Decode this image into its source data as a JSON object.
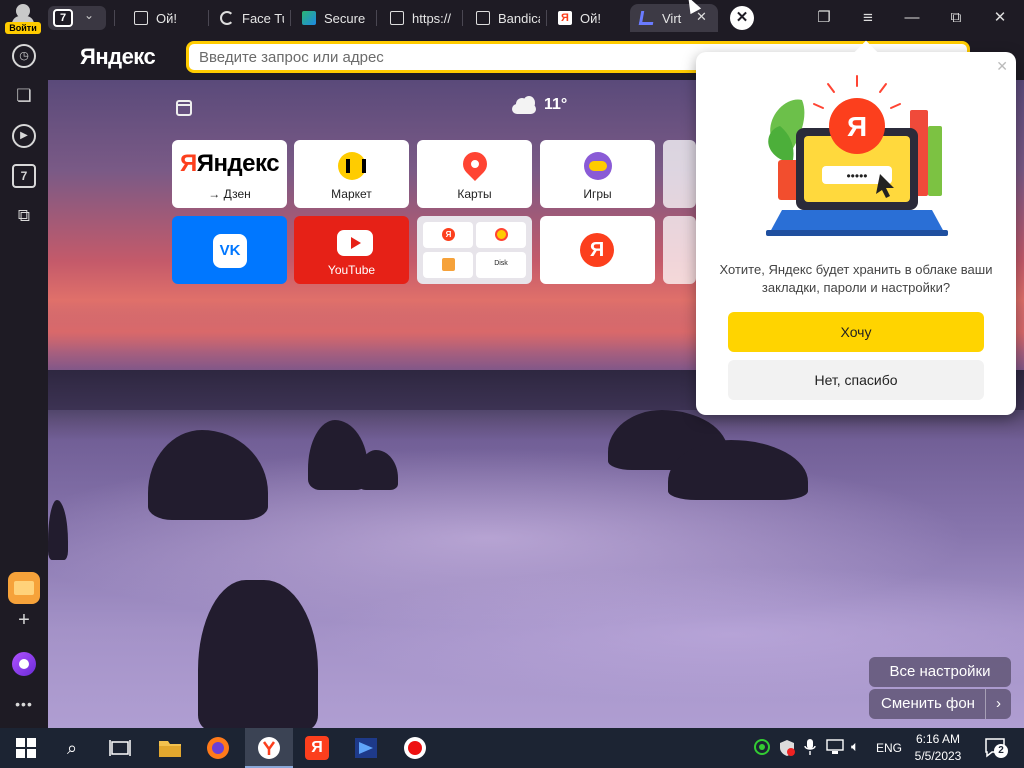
{
  "window": {
    "login_label": "Войти",
    "tab_count": "7",
    "tabs": [
      {
        "label": "Ой!",
        "icon": "document-icon"
      },
      {
        "label": "Face Tu",
        "icon": "loading-spinner-icon"
      },
      {
        "label": "Secure",
        "icon": "site-icon"
      },
      {
        "label": "https://",
        "icon": "document-icon"
      },
      {
        "label": "Bandica",
        "icon": "document-icon"
      },
      {
        "label": "Ой!",
        "icon": "yandex-icon"
      },
      {
        "label": "Virt",
        "icon": "site-icon",
        "active": true
      }
    ]
  },
  "addressbar": {
    "logo": "Яндекс",
    "placeholder": "Введите запрос или адрес"
  },
  "newtab": {
    "weather": "11°",
    "tiles": [
      {
        "label": "→ Дзен",
        "brand": "Яндекс"
      },
      {
        "label": "Маркет"
      },
      {
        "label": "Карты"
      },
      {
        "label": "Игры"
      },
      {
        "label": "VK",
        "icon": "vk-icon"
      },
      {
        "label": "YouTube"
      },
      {
        "label": "",
        "group": [
          "Я",
          "",
          "",
          "Disk"
        ]
      },
      {
        "label": "",
        "brand": "Я"
      }
    ],
    "all_settings": "Все настройки",
    "change_bg": "Сменить фон",
    "change_bg_arrow": "›"
  },
  "popup": {
    "badge": "Я",
    "password_dots": "•••••",
    "message": "Хотите, Яндекс будет хранить в облаке ваши закладки, пароли и настройки?",
    "accept": "Хочу",
    "decline": "Нет, спасибо"
  },
  "taskbar": {
    "lang": "ENG",
    "time": "6:16 AM",
    "date": "5/5/2023",
    "notifications": "2"
  },
  "colors": {
    "accent": "#ffcc00",
    "brand_red": "#fc3f1d",
    "vk": "#0077ff",
    "youtube": "#e62117"
  }
}
